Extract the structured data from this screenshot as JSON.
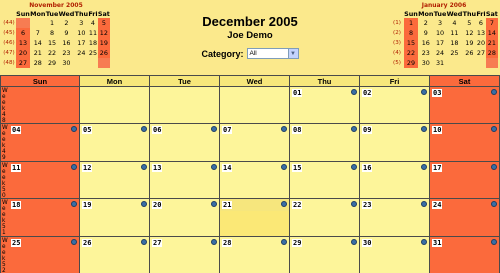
{
  "title": "December 2005",
  "subtitle": "Joe Demo",
  "category": {
    "label": "Category:",
    "value": "All"
  },
  "mini_prev": {
    "title": "November 2005",
    "headers": [
      "Sun",
      "Mon",
      "Tue",
      "Wed",
      "Thu",
      "Fri",
      "Sat"
    ],
    "weeks": [
      {
        "wk": "(44)",
        "days": [
          "",
          "",
          "1",
          "2",
          "3",
          "4",
          "5"
        ]
      },
      {
        "wk": "(45)",
        "days": [
          "6",
          "7",
          "8",
          "9",
          "10",
          "11",
          "12"
        ]
      },
      {
        "wk": "(46)",
        "days": [
          "13",
          "14",
          "15",
          "16",
          "17",
          "18",
          "19"
        ]
      },
      {
        "wk": "(47)",
        "days": [
          "20",
          "21",
          "22",
          "23",
          "24",
          "25",
          "26"
        ]
      },
      {
        "wk": "(48)",
        "days": [
          "27",
          "28",
          "29",
          "30",
          "",
          "",
          ""
        ]
      }
    ]
  },
  "mini_next": {
    "title": "January 2006",
    "headers": [
      "Sun",
      "Mon",
      "Tue",
      "Wed",
      "Thu",
      "Fri",
      "Sat"
    ],
    "weeks": [
      {
        "wk": "(1)",
        "days": [
          "1",
          "2",
          "3",
          "4",
          "5",
          "6",
          "7"
        ]
      },
      {
        "wk": "(2)",
        "days": [
          "8",
          "9",
          "10",
          "11",
          "12",
          "13",
          "14"
        ]
      },
      {
        "wk": "(3)",
        "days": [
          "15",
          "16",
          "17",
          "18",
          "19",
          "20",
          "21"
        ]
      },
      {
        "wk": "(4)",
        "days": [
          "22",
          "23",
          "24",
          "25",
          "26",
          "27",
          "28"
        ]
      },
      {
        "wk": "(5)",
        "days": [
          "29",
          "30",
          "31",
          "",
          "",
          "",
          ""
        ]
      }
    ]
  },
  "main": {
    "headers": [
      "Sun",
      "Mon",
      "Tue",
      "Wed",
      "Thu",
      "Fri",
      "Sat"
    ],
    "weeks": [
      {
        "wk": [
          "W",
          "e",
          "e",
          "k",
          "4",
          "8"
        ],
        "days": [
          "",
          "",
          "",
          "",
          "01",
          "02",
          "03"
        ]
      },
      {
        "wk": [
          "W",
          "e",
          "e",
          "k",
          "4",
          "9"
        ],
        "days": [
          "04",
          "05",
          "06",
          "07",
          "08",
          "09",
          "10"
        ]
      },
      {
        "wk": [
          "W",
          "e",
          "e",
          "k",
          "5",
          "0"
        ],
        "days": [
          "11",
          "12",
          "13",
          "14",
          "15",
          "16",
          "17"
        ]
      },
      {
        "wk": [
          "W",
          "e",
          "e",
          "k",
          "5",
          "1"
        ],
        "days": [
          "18",
          "19",
          "20",
          "21",
          "22",
          "23",
          "24"
        ]
      },
      {
        "wk": [
          "W",
          "e",
          "e",
          "k",
          "5",
          "2"
        ],
        "days": [
          "25",
          "26",
          "27",
          "28",
          "29",
          "30",
          "31"
        ]
      }
    ],
    "today": "21"
  },
  "colors": {
    "background": "#fbe98c",
    "weekend": "#fb6a3c",
    "cell": "#fdf59a",
    "accent": "#b11f00"
  }
}
